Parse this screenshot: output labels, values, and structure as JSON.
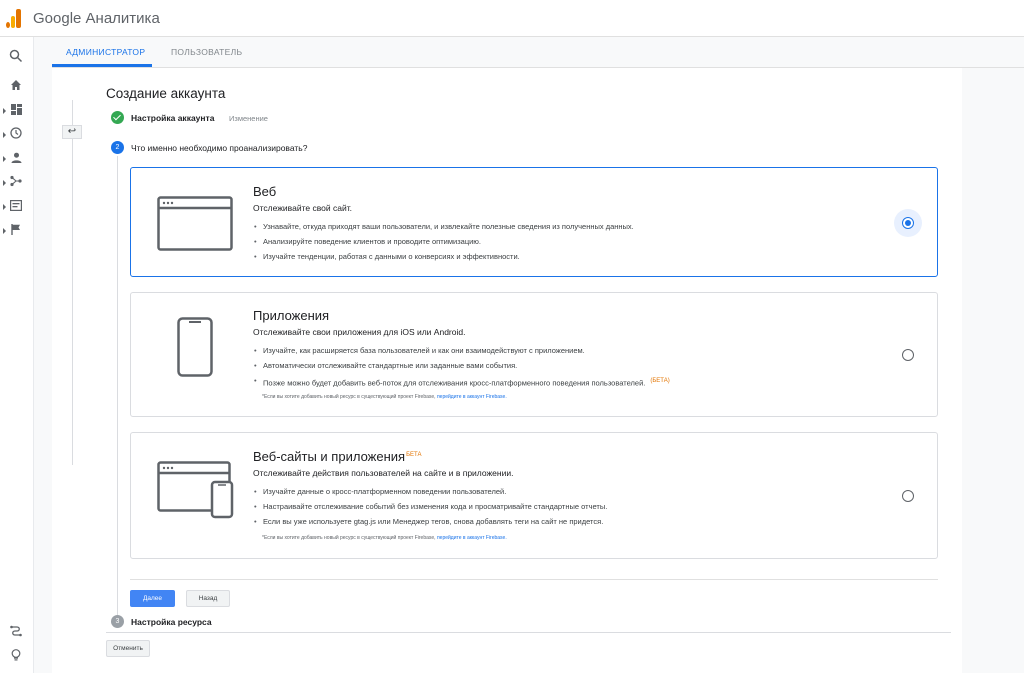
{
  "header": {
    "app_title": "Google Аналитика"
  },
  "tabs": [
    {
      "label": "АДМИНИСТРАТОР"
    },
    {
      "label": "ПОЛЬЗОВАТЕЛЬ"
    }
  ],
  "page": {
    "title": "Создание аккаунта",
    "step1": {
      "label": "Настройка аккаунта",
      "edit": "Изменение"
    },
    "step2": {
      "number": "2",
      "label": "Что именно необходимо проанализировать?"
    },
    "step3": {
      "number": "3",
      "label": "Настройка ресурса"
    }
  },
  "options": [
    {
      "title": "Веб",
      "subtitle": "Отслеживайте свой сайт.",
      "bullets": [
        "Узнавайте, откуда приходят ваши пользователи, и извлекайте полезные сведения из полученных данных.",
        "Анализируйте поведение клиентов и проводите оптимизацию.",
        "Изучайте тенденции, работая с данными о конверсиях и эффективности."
      ],
      "selected": true
    },
    {
      "title": "Приложения",
      "subtitle": "Отслеживайте свои приложения для iOS или Android.",
      "bullets": [
        "Изучайте, как расширяется база пользователей и как они взаимодействуют с приложением.",
        "Автоматически отслеживайте стандартные или заданные вами события.",
        "Позже можно будет добавить веб-поток для отслеживания кросс-платформенного поведения пользователей."
      ],
      "beta_tag": "(БЕТА)",
      "note": "*Если вы хотите добавить новый ресурс в существующий проект Firebase,",
      "note_link": "перейдите в аккаунт Firebase.",
      "selected": false
    },
    {
      "title": "Веб-сайты и приложения",
      "title_beta": "БЕТА",
      "subtitle": "Отслеживайте действия пользователей на сайте и в приложении.",
      "bullets": [
        "Изучайте данные о кросс-платформенном поведении пользователей.",
        "Настраивайте отслеживание событий без изменения кода и просматривайте стандартные отчеты.",
        "Если вы уже используете gtag.js или Менеджер тегов, снова добавлять теги на сайт не придется."
      ],
      "note": "*Если вы хотите добавить новый ресурс в существующий проект Firebase,",
      "note_link": "перейдите в аккаунт Firebase.",
      "selected": false
    }
  ],
  "buttons": {
    "next": "Далее",
    "back": "Назад",
    "cancel": "Отменить"
  },
  "icons": [
    "search-icon",
    "home-icon",
    "dashboard-icon",
    "clock-icon",
    "person-icon",
    "acquisition-icon",
    "behavior-icon",
    "flag-icon",
    "attribution-icon",
    "lightbulb-icon"
  ],
  "colors": {
    "accent": "#1a73e8",
    "success": "#34a853",
    "beta": "#e37400"
  }
}
